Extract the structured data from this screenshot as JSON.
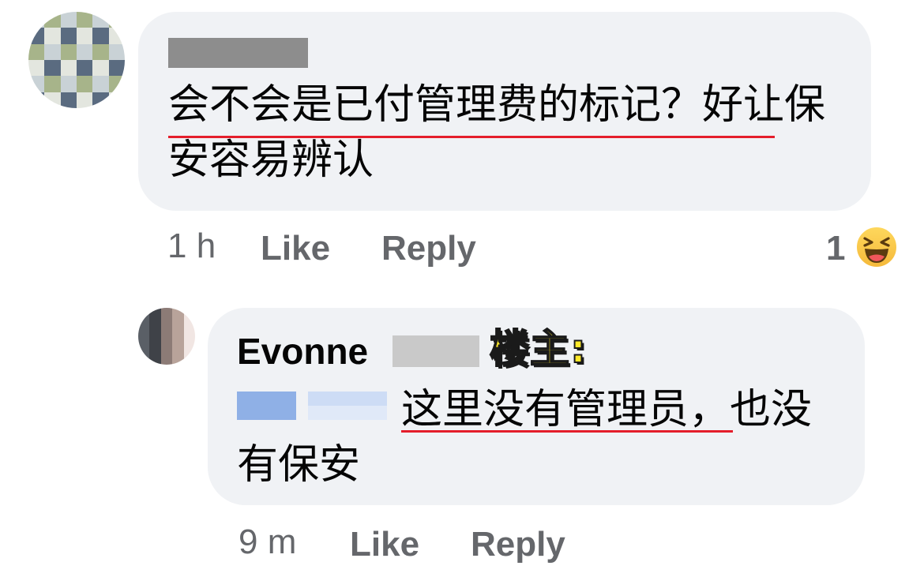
{
  "comments": [
    {
      "text": "会不会是已付管理费的标记？好让保安容易辨认",
      "time": "1 h",
      "like_label": "Like",
      "reply_label": "Reply",
      "reaction_count": "1",
      "reaction_icon": "haha-emoji-icon"
    }
  ],
  "reply": {
    "author": "Evonne",
    "op_tag": "楼主:",
    "text": "这里没有管理员，也没有保安",
    "time": "9 m",
    "like_label": "Like",
    "reply_label": "Reply"
  },
  "colors": {
    "bubble": "#f0f2f5",
    "meta_text": "#65676b",
    "underline": "#e41e2b",
    "op_tag": "#ffe92a"
  }
}
